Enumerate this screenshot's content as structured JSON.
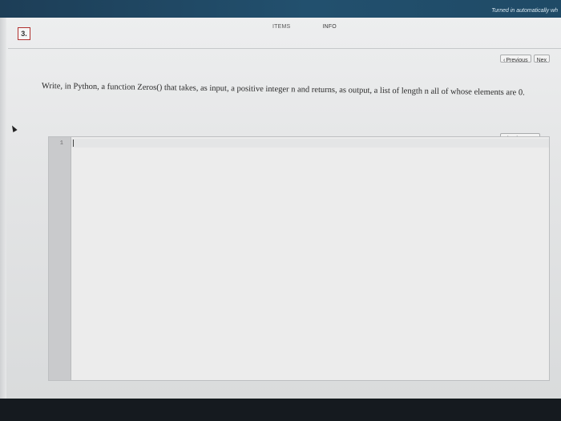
{
  "header": {
    "status": "Turned in automatically wh"
  },
  "question": {
    "number": "3."
  },
  "tabs": [
    {
      "label": "ITEMS"
    },
    {
      "label": "INFO"
    }
  ],
  "navigation": {
    "previous_label": "Previous",
    "next_label": "Nex"
  },
  "prompt": {
    "text": "Write, in Python, a function Zeros() that takes, as input, a positive integer n and returns, as output, a list of length n all of whose elements are 0."
  },
  "editor": {
    "check_syntax_label": "Check syntax",
    "line_numbers": [
      "1"
    ]
  },
  "icons": {
    "previous": "chevron-left-icon"
  }
}
